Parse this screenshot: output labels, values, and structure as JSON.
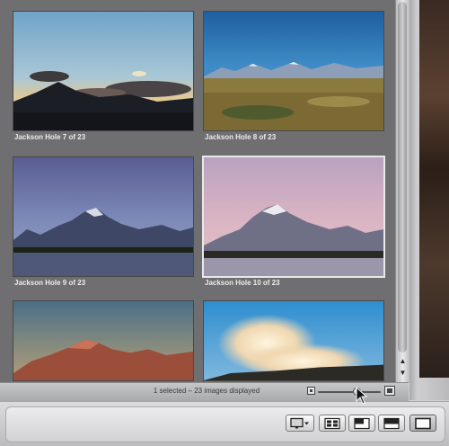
{
  "browser": {
    "thumbnails": [
      {
        "label": "Jackson Hole 7 of 23",
        "scene": "sunset-clouds"
      },
      {
        "label": "Jackson Hole 8 of 23",
        "scene": "prairie-mountains"
      },
      {
        "label": "Jackson Hole 9 of 23",
        "scene": "blue-dusk-peaks"
      },
      {
        "label": "Jackson Hole 10 of 23",
        "scene": "pink-dusk-peaks",
        "selected": true
      },
      {
        "label": "",
        "scene": "alpenglow-peaks"
      },
      {
        "label": "",
        "scene": "geyser-steam"
      }
    ]
  },
  "status": {
    "text": "1 selected – 23 images displayed",
    "zoom_level": 0.62
  },
  "toolbar": {
    "buttons": [
      {
        "name": "viewer-menu-button",
        "icon": "monitor-dropdown-icon"
      },
      {
        "name": "browser-view-button",
        "icon": "grid-view-icon"
      },
      {
        "name": "split-view-button",
        "icon": "split-view-icon"
      },
      {
        "name": "filmstrip-view-button",
        "icon": "filmstrip-icon"
      },
      {
        "name": "viewer-only-button",
        "icon": "viewer-icon",
        "active": true
      }
    ]
  },
  "colors": {
    "grid_background": "#6f6f71",
    "label_text": "#ececec",
    "status_text": "#3a3a3a"
  }
}
